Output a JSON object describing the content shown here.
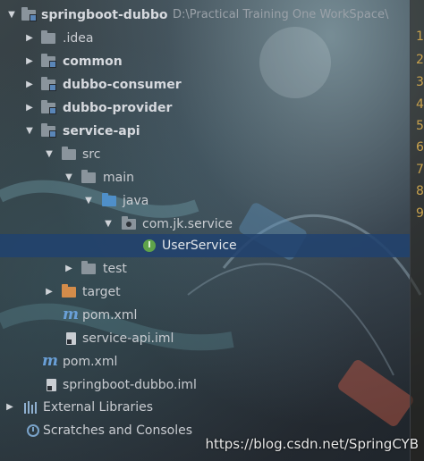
{
  "project_tree": {
    "root": {
      "name": "springboot-dubbo",
      "path": "D:\\Practical Training One WorkSpace\\"
    },
    "items": [
      {
        "label": ".idea"
      },
      {
        "label": "common"
      },
      {
        "label": "dubbo-consumer"
      },
      {
        "label": "dubbo-provider"
      },
      {
        "label": "service-api"
      },
      {
        "label": "src"
      },
      {
        "label": "main"
      },
      {
        "label": "java"
      },
      {
        "label": "com.jk.service"
      },
      {
        "label": "UserService"
      },
      {
        "label": "test"
      },
      {
        "label": "target"
      },
      {
        "label": "pom.xml"
      },
      {
        "label": "service-api.iml"
      },
      {
        "label": "pom.xml"
      },
      {
        "label": "springboot-dubbo.iml"
      },
      {
        "label": "External Libraries"
      },
      {
        "label": "Scratches and Consoles"
      }
    ]
  },
  "gutter": {
    "line_numbers": [
      "1",
      "2",
      "3",
      "4",
      "5",
      "6",
      "7",
      "8",
      "9"
    ],
    "color": "#c9a24d"
  },
  "watermark": "https://blog.csdn.net/SpringCYB",
  "colors": {
    "selection": "#21426e",
    "folder_gray": "#8a949c",
    "folder_blue": "#4f8fc9",
    "folder_orange": "#d48c4a",
    "interface_green": "#5fa34a",
    "maven_blue": "#6aa0d8"
  },
  "icons": {
    "expanded": "triangle-down",
    "collapsed": "triangle-right"
  }
}
